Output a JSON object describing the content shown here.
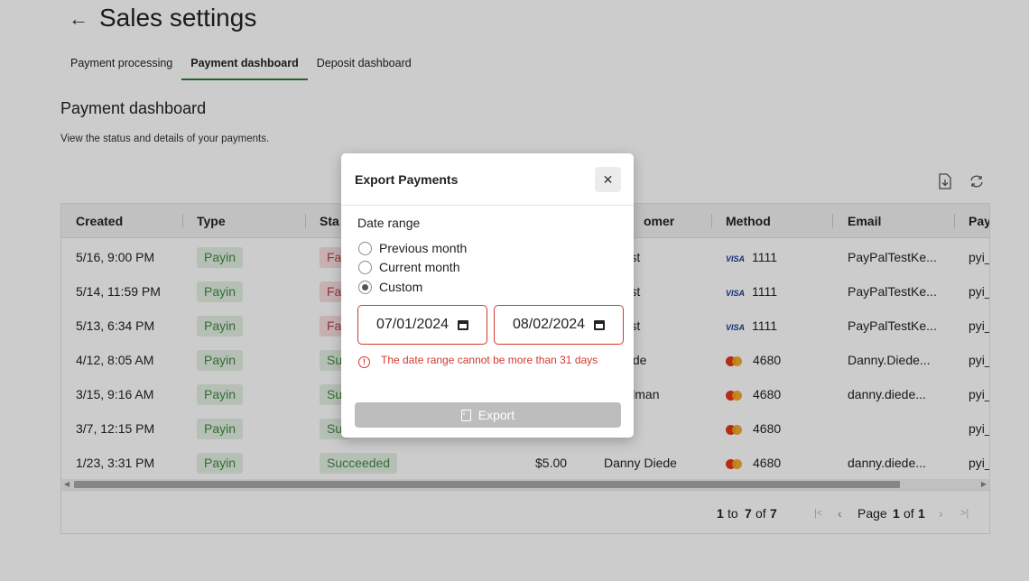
{
  "header": {
    "back_icon": "left-arrow-icon",
    "title": "Sales settings"
  },
  "tabs": [
    {
      "label": "Payment processing",
      "active": false
    },
    {
      "label": "Payment dashboard",
      "active": true
    },
    {
      "label": "Deposit dashboard",
      "active": false
    }
  ],
  "section": {
    "title": "Payment dashboard",
    "description": "View the status and details of your payments."
  },
  "toolbar": {
    "download_icon": "download-icon",
    "refresh_icon": "refresh-icon"
  },
  "table": {
    "columns": [
      "Created",
      "Type",
      "Sta",
      "omer",
      "Method",
      "Email",
      "Pay"
    ],
    "rows": [
      {
        "created": "5/16, 9:00 PM",
        "type": "Payin",
        "status": "Fai",
        "status_color": "red",
        "amount": "",
        "customer": "al Test",
        "method_brand": "VISA",
        "method_last4": "1111",
        "email": "PayPalTestKe...",
        "pay": "pyi_"
      },
      {
        "created": "5/14, 11:59 PM",
        "type": "Payin",
        "status": "Fai",
        "status_color": "red",
        "amount": "",
        "customer": "al Test",
        "method_brand": "VISA",
        "method_last4": "1111",
        "email": "PayPalTestKe...",
        "pay": "pyi_"
      },
      {
        "created": "5/13, 6:34 PM",
        "type": "Payin",
        "status": "Fai",
        "status_color": "red",
        "amount": "",
        "customer": "al Test",
        "method_brand": "VISA",
        "method_last4": "1111",
        "email": "PayPalTestKe...",
        "pay": "pyi_"
      },
      {
        "created": "4/12, 8:05 AM",
        "type": "Payin",
        "status": "Su",
        "status_color": "green",
        "amount": "",
        "customer": "y Diede",
        "method_brand": "MC",
        "method_last4": "4680",
        "email": "Danny.Diede...",
        "pay": "pyi_"
      },
      {
        "created": "3/15, 9:16 AM",
        "type": "Payin",
        "status": "Su",
        "status_color": "green",
        "amount": "",
        "customer": "Goodman",
        "method_brand": "MC",
        "method_last4": "4680",
        "email": "danny.diede...",
        "pay": "pyi_"
      },
      {
        "created": "3/7, 12:15 PM",
        "type": "Payin",
        "status": "Su",
        "status_color": "green",
        "amount": "",
        "customer": "",
        "method_brand": "MC",
        "method_last4": "4680",
        "email": "",
        "pay": "pyi_"
      },
      {
        "created": "1/23, 3:31 PM",
        "type": "Payin",
        "status": "Succeeded",
        "status_color": "green",
        "amount": "$5.00",
        "customer": "Danny Diede",
        "method_brand": "MC",
        "method_last4": "4680",
        "email": "danny.diede...",
        "pay": "pyi_"
      }
    ]
  },
  "pager": {
    "range_from": "1",
    "to_word": "to",
    "range_to": "7",
    "of_word": "of",
    "total": "7",
    "page_word": "Page",
    "page": "1",
    "page_of_word": "of",
    "page_total": "1"
  },
  "modal": {
    "title": "Export Payments",
    "close_icon": "close-icon",
    "date_range_label": "Date range",
    "options": [
      {
        "label": "Previous month",
        "checked": false
      },
      {
        "label": "Current month",
        "checked": false
      },
      {
        "label": "Custom",
        "checked": true
      }
    ],
    "start_date": "07/01/2024",
    "end_date": "08/02/2024",
    "error": "The date range cannot be more than 31 days",
    "export_label": "Export",
    "colors": {
      "error": "#d23a2e",
      "disabled_button": "#bdbdbd",
      "tab_underline": "#2e7d32"
    }
  }
}
